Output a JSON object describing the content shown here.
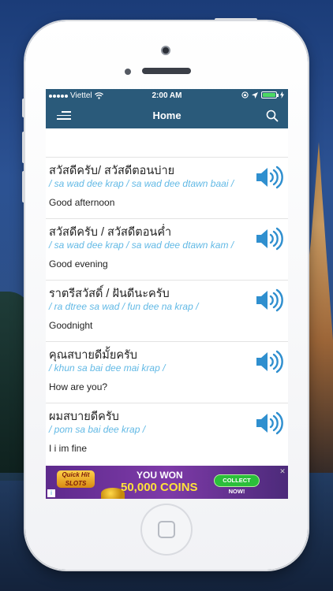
{
  "statusbar": {
    "carrier": "Viettel",
    "time": "2:00 AM",
    "battery_level": 1.0,
    "battery_color": "#4cd964"
  },
  "navbar": {
    "title": "Home",
    "menu_icon": "hamburger-menu-icon",
    "search_icon": "search-icon"
  },
  "theme": {
    "bar_color": "#2a5a7a",
    "romanization_color": "#62b9e5",
    "speaker_color": "#2f8fcf"
  },
  "phrases": [
    {
      "thai": "สวัสดีครับ/ สวัสดีตอนบ่าย",
      "roman": "/ sa wad dee krap / sa wad dee dtawn baai /",
      "english": "Good afternoon"
    },
    {
      "thai": "สวัสดีครับ / สวัสดีตอนค่ำ",
      "roman": "/ sa wad dee krap / sa wad dee dtawn kam /",
      "english": "Good evening"
    },
    {
      "thai": "ราตรีสวัสดิ์ / ฝันดีนะครับ",
      "roman": "/ ra dtree sa wad / fun dee na krap /",
      "english": "Goodnight"
    },
    {
      "thai": "คุณสบายดีมั้ยครับ",
      "roman": "/ khun sa bai dee mai krap /",
      "english": "How are you?"
    },
    {
      "thai": "ผมสบายดีครับ",
      "roman": "/ pom sa bai dee krap /",
      "english": "I i im fine"
    }
  ],
  "ad": {
    "logo_text_1": "Quick Hit",
    "logo_text_2": "SLOTS",
    "headline_1": "YOU WON",
    "headline_2": "50,000 COINS",
    "cta": "COLLECT NOW!",
    "close_label": "✕",
    "adchoices_label": "i"
  }
}
